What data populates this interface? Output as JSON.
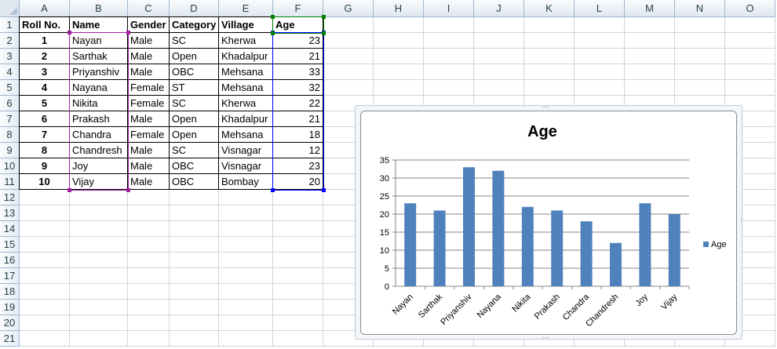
{
  "columns": [
    "A",
    "B",
    "C",
    "D",
    "E",
    "F",
    "G",
    "H",
    "I",
    "J",
    "K",
    "L",
    "M",
    "N",
    "O"
  ],
  "rows": [
    "1",
    "2",
    "3",
    "4",
    "5",
    "6",
    "7",
    "8",
    "9",
    "10",
    "11",
    "12",
    "13",
    "14",
    "15",
    "16",
    "17",
    "18",
    "19",
    "20",
    "21"
  ],
  "table": {
    "headers": [
      "Roll No.",
      "Name",
      "Gender",
      "Category",
      "Village",
      "Age"
    ],
    "records": [
      [
        "1",
        "Nayan",
        "Male",
        "SC",
        "Kherwa",
        "23"
      ],
      [
        "2",
        "Sarthak",
        "Male",
        "Open",
        "Khadalpur",
        "21"
      ],
      [
        "3",
        "Priyanshiv",
        "Male",
        "OBC",
        "Mehsana",
        "33"
      ],
      [
        "4",
        "Nayana",
        "Female",
        "ST",
        "Mehsana",
        "32"
      ],
      [
        "5",
        "Nikita",
        "Female",
        "SC",
        "Kherwa",
        "22"
      ],
      [
        "6",
        "Prakash",
        "Male",
        "Open",
        "Khadalpur",
        "21"
      ],
      [
        "7",
        "Chandra",
        "Female",
        "Open",
        "Mehsana",
        "18"
      ],
      [
        "8",
        "Chandresh",
        "Male",
        "SC",
        "Visnagar",
        "12"
      ],
      [
        "9",
        "Joy",
        "Male",
        "OBC",
        "Visnagar",
        "23"
      ],
      [
        "10",
        "Vijay",
        "Male",
        "OBC",
        "Bombay",
        "20"
      ]
    ]
  },
  "colors": {
    "bar": "#4f81bd",
    "gridline": "#868686",
    "name_range_border": "#a020a0",
    "age_range_border": "#0000ff",
    "header_range_handle": "#008000"
  },
  "chart_data": {
    "type": "bar",
    "title": "Age",
    "categories": [
      "Nayan",
      "Sarthak",
      "Priyanshiv",
      "Nayana",
      "Nikita",
      "Prakash",
      "Chandra",
      "Chandresh",
      "Joy",
      "Vijay"
    ],
    "series": [
      {
        "name": "Age",
        "values": [
          23,
          21,
          33,
          32,
          22,
          21,
          18,
          12,
          23,
          20
        ]
      }
    ],
    "ylim": [
      0,
      35
    ],
    "yticks": [
      "0",
      "5",
      "10",
      "15",
      "20",
      "25",
      "30",
      "35"
    ],
    "grid": true,
    "legend": "right"
  }
}
